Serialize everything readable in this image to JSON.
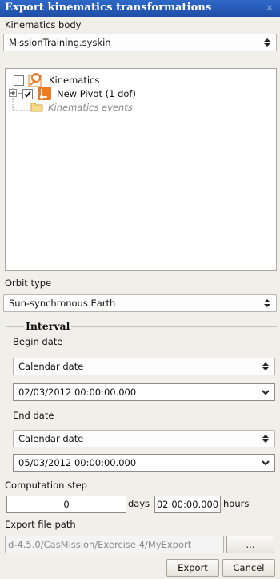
{
  "window": {
    "title": "Export kinematics transformations",
    "close_glyph": "×"
  },
  "kinematics_body": {
    "label": "Kinematics body",
    "value": "MissionTraining.syskin"
  },
  "tree": {
    "items": [
      {
        "label": "Kinematics",
        "checked": false,
        "icon": "kinematics-icon"
      },
      {
        "label": "New Pivot (1 dof)",
        "checked": true,
        "icon": "pivot-icon"
      },
      {
        "label": "Kinematics events",
        "icon": "folder-icon"
      }
    ]
  },
  "orbit_type": {
    "label": "Orbit type",
    "value": "Sun-synchronous Earth"
  },
  "interval": {
    "legend": "Interval",
    "begin": {
      "label": "Begin date",
      "format": "Calendar date",
      "value": "02/03/2012 00:00:00.000"
    },
    "end": {
      "label": "End date",
      "format": "Calendar date",
      "value": "05/03/2012 00:00:00.000"
    }
  },
  "computation_step": {
    "label": "Computation step",
    "days_value": "0",
    "days_unit": "days",
    "hours_value": "02:00:00.000",
    "hours_unit": "hours"
  },
  "export_path": {
    "label": "Export file path",
    "value": "d-4.5.0/CasMission/Exercise 4/MyExport",
    "browse_label": "..."
  },
  "buttons": {
    "export": "Export",
    "cancel": "Cancel"
  },
  "colors": {
    "titlebar": "#1f4fa6",
    "background": "#f1efe9",
    "disabled_text": "#8b8b8b"
  }
}
